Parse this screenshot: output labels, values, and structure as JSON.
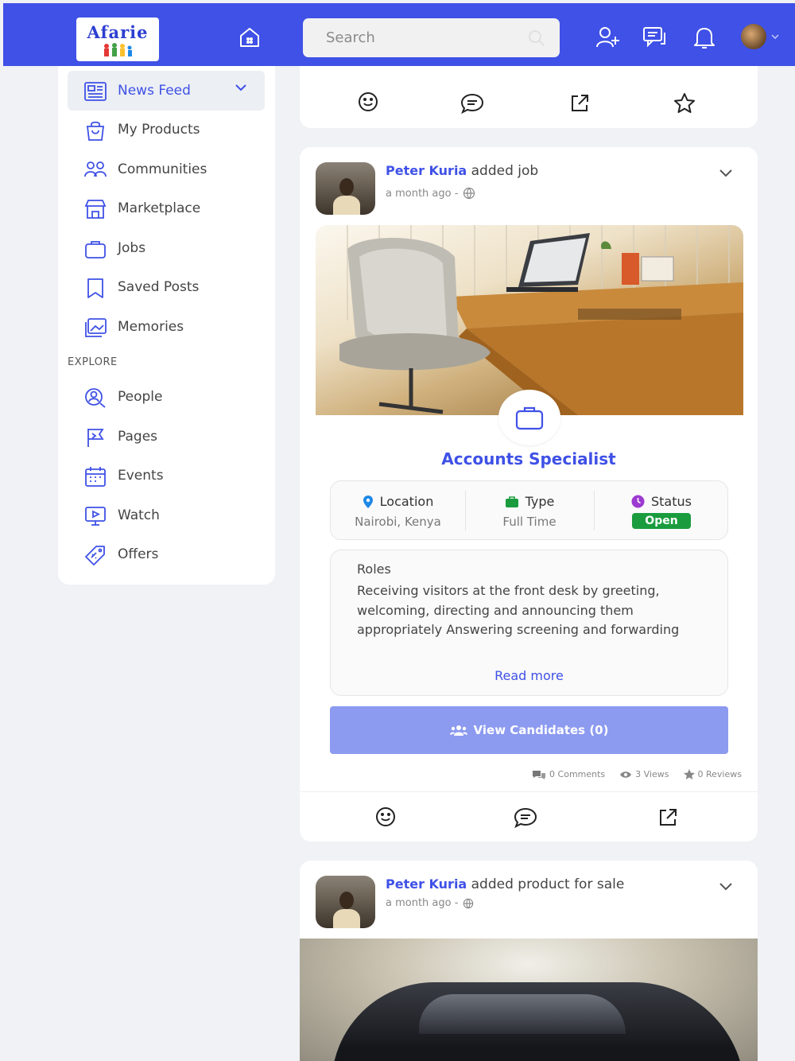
{
  "app": {
    "logo_text": "Afarie"
  },
  "header": {
    "search_placeholder": "Search"
  },
  "sidebar": {
    "items": [
      {
        "label": "News Feed"
      },
      {
        "label": "My Products"
      },
      {
        "label": "Communities"
      },
      {
        "label": "Marketplace"
      },
      {
        "label": "Jobs"
      },
      {
        "label": "Saved Posts"
      },
      {
        "label": "Memories"
      }
    ],
    "explore_label": "EXPLORE",
    "explore_items": [
      {
        "label": "People"
      },
      {
        "label": "Pages"
      },
      {
        "label": "Events"
      },
      {
        "label": "Watch"
      },
      {
        "label": "Offers"
      }
    ]
  },
  "colors": {
    "brand": "#3f51e6",
    "status_open": "#1a9c3e",
    "button": "#8c9af0"
  },
  "posts": [
    {
      "author": "Peter Kuria",
      "action": "added job",
      "time": "a month ago -",
      "job": {
        "title": "Accounts Specialist",
        "location_label": "Location",
        "location_value": "Nairobi, Kenya",
        "type_label": "Type",
        "type_value": "Full Time",
        "status_label": "Status",
        "status_value": "Open",
        "roles_title": "Roles",
        "roles_text": "Receiving visitors at the front desk by greeting, welcoming, directing and announcing them appropriately Answering screening and forwarding",
        "read_more": "Read more",
        "view_button": "View Candidates (0)"
      },
      "stats": {
        "comments": "0 Comments",
        "views": "3 Views",
        "reviews": "0 Reviews"
      }
    },
    {
      "author": "Peter Kuria",
      "action": "added product for sale",
      "time": "a month ago -"
    }
  ]
}
